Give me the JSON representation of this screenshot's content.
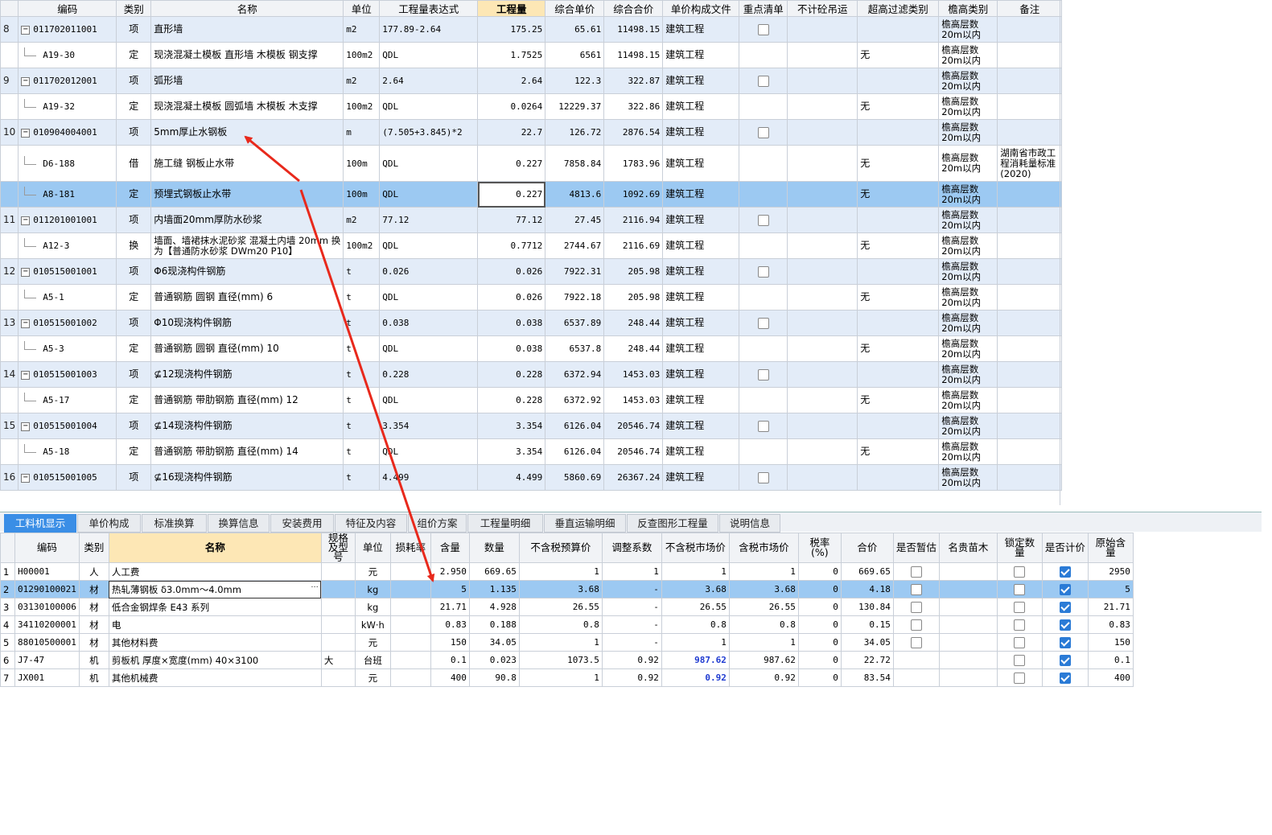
{
  "top_table": {
    "headers": [
      "",
      "编码",
      "类别",
      "名称",
      "单位",
      "工程量表达式",
      "工程量",
      "综合单价",
      "综合合价",
      "单价构成文件",
      "重点清单",
      "不计砼吊运",
      "超高过滤类别",
      "檐高类别",
      "备注"
    ],
    "rows": [
      {
        "rn": "8",
        "kind": "parent",
        "code": "011702011001",
        "type": "项",
        "name": "直形墙",
        "unit": "m2",
        "expr": "177.89-2.64",
        "qty": "175.25",
        "uprice": "65.61",
        "total": "11498.15",
        "file": "建筑工程",
        "filter": "",
        "eave": "檐高层数20m以内",
        "note": ""
      },
      {
        "rn": "",
        "kind": "child",
        "code": "A19-30",
        "type": "定",
        "name": "现浇混凝土模板 直形墙 木模板 钢支撑",
        "unit": "100m2",
        "expr": "QDL",
        "qty": "1.7525",
        "uprice": "6561",
        "total": "11498.15",
        "file": "建筑工程",
        "filter": "无",
        "eave": "檐高层数20m以内",
        "note": ""
      },
      {
        "rn": "9",
        "kind": "parent",
        "code": "011702012001",
        "type": "项",
        "name": "弧形墙",
        "unit": "m2",
        "expr": "2.64",
        "qty": "2.64",
        "uprice": "122.3",
        "total": "322.87",
        "file": "建筑工程",
        "filter": "",
        "eave": "檐高层数20m以内",
        "note": ""
      },
      {
        "rn": "",
        "kind": "child",
        "code": "A19-32",
        "type": "定",
        "name": "现浇混凝土模板 圆弧墙 木模板 木支撑",
        "unit": "100m2",
        "expr": "QDL",
        "qty": "0.0264",
        "uprice": "12229.37",
        "total": "322.86",
        "file": "建筑工程",
        "filter": "无",
        "eave": "檐高层数20m以内",
        "note": ""
      },
      {
        "rn": "10",
        "kind": "parent",
        "code": "010904004001",
        "type": "项",
        "name": "5mm厚止水钢板",
        "unit": "m",
        "expr": "(7.505+3.845)*2",
        "qty": "22.7",
        "uprice": "126.72",
        "total": "2876.54",
        "file": "建筑工程",
        "filter": "",
        "eave": "檐高层数20m以内",
        "note": ""
      },
      {
        "rn": "",
        "kind": "child tall",
        "code": "D6-188",
        "type": "借",
        "name": "施工缝 钢板止水带",
        "unit": "100m",
        "expr": "QDL",
        "qty": "0.227",
        "uprice": "7858.84",
        "total": "1783.96",
        "file": "建筑工程",
        "filter": "无",
        "eave": "檐高层数20m以内",
        "note": "湖南省市政工程消耗量标准(2020)"
      },
      {
        "rn": "",
        "kind": "sel",
        "code": "A8-181",
        "type": "定",
        "name": "预埋式钢板止水带",
        "unit": "100m",
        "expr": "QDL",
        "qty": "0.227",
        "uprice": "4813.6",
        "total": "1092.69",
        "file": "建筑工程",
        "filter": "无",
        "eave": "檐高层数20m以内",
        "note": ""
      },
      {
        "rn": "11",
        "kind": "parent",
        "code": "011201001001",
        "type": "项",
        "name": "内墙面20mm厚防水砂浆",
        "unit": "m2",
        "expr": "77.12",
        "qty": "77.12",
        "uprice": "27.45",
        "total": "2116.94",
        "file": "建筑工程",
        "filter": "",
        "eave": "檐高层数20m以内",
        "note": ""
      },
      {
        "rn": "",
        "kind": "child",
        "code": "A12-3",
        "type": "换",
        "name": "墙面、墙裙抹水泥砂浆 混凝土内墙 20mm 换为【普通防水砂浆 DWm20 P10】",
        "unit": "100m2",
        "expr": "QDL",
        "qty": "0.7712",
        "uprice": "2744.67",
        "total": "2116.69",
        "file": "建筑工程",
        "filter": "无",
        "eave": "檐高层数20m以内",
        "note": ""
      },
      {
        "rn": "12",
        "kind": "parent",
        "code": "010515001001",
        "type": "项",
        "name": "Φ6现浇构件钢筋",
        "unit": "t",
        "expr": "0.026",
        "qty": "0.026",
        "uprice": "7922.31",
        "total": "205.98",
        "file": "建筑工程",
        "filter": "",
        "eave": "檐高层数20m以内",
        "note": ""
      },
      {
        "rn": "",
        "kind": "child",
        "code": "A5-1",
        "type": "定",
        "name": "普通钢筋 圆钢 直径(mm) 6",
        "unit": "t",
        "expr": "QDL",
        "qty": "0.026",
        "uprice": "7922.18",
        "total": "205.98",
        "file": "建筑工程",
        "filter": "无",
        "eave": "檐高层数20m以内",
        "note": ""
      },
      {
        "rn": "13",
        "kind": "parent",
        "code": "010515001002",
        "type": "项",
        "name": "Φ10现浇构件钢筋",
        "unit": "t",
        "expr": "0.038",
        "qty": "0.038",
        "uprice": "6537.89",
        "total": "248.44",
        "file": "建筑工程",
        "filter": "",
        "eave": "檐高层数20m以内",
        "note": ""
      },
      {
        "rn": "",
        "kind": "child",
        "code": "A5-3",
        "type": "定",
        "name": "普通钢筋 圆钢 直径(mm) 10",
        "unit": "t",
        "expr": "QDL",
        "qty": "0.038",
        "uprice": "6537.8",
        "total": "248.44",
        "file": "建筑工程",
        "filter": "无",
        "eave": "檐高层数20m以内",
        "note": ""
      },
      {
        "rn": "14",
        "kind": "parent",
        "code": "010515001003",
        "type": "项",
        "name": "⊈12现浇构件钢筋",
        "unit": "t",
        "expr": "0.228",
        "qty": "0.228",
        "uprice": "6372.94",
        "total": "1453.03",
        "file": "建筑工程",
        "filter": "",
        "eave": "檐高层数20m以内",
        "note": ""
      },
      {
        "rn": "",
        "kind": "child",
        "code": "A5-17",
        "type": "定",
        "name": "普通钢筋 带肋钢筋 直径(mm) 12",
        "unit": "t",
        "expr": "QDL",
        "qty": "0.228",
        "uprice": "6372.92",
        "total": "1453.03",
        "file": "建筑工程",
        "filter": "无",
        "eave": "檐高层数20m以内",
        "note": ""
      },
      {
        "rn": "15",
        "kind": "parent",
        "code": "010515001004",
        "type": "项",
        "name": "⊈14现浇构件钢筋",
        "unit": "t",
        "expr": "3.354",
        "qty": "3.354",
        "uprice": "6126.04",
        "total": "20546.74",
        "file": "建筑工程",
        "filter": "",
        "eave": "檐高层数20m以内",
        "note": ""
      },
      {
        "rn": "",
        "kind": "child",
        "code": "A5-18",
        "type": "定",
        "name": "普通钢筋 带肋钢筋 直径(mm) 14",
        "unit": "t",
        "expr": "QDL",
        "qty": "3.354",
        "uprice": "6126.04",
        "total": "20546.74",
        "file": "建筑工程",
        "filter": "无",
        "eave": "檐高层数20m以内",
        "note": ""
      },
      {
        "rn": "16",
        "kind": "parent",
        "code": "010515001005",
        "type": "项",
        "name": "⊈16现浇构件钢筋",
        "unit": "t",
        "expr": "4.499",
        "qty": "4.499",
        "uprice": "5860.69",
        "total": "26367.24",
        "file": "建筑工程",
        "filter": "",
        "eave": "檐高层数20m以内",
        "note": ""
      }
    ]
  },
  "tabs": [
    "工料机显示",
    "单价构成",
    "标准换算",
    "换算信息",
    "安装费用",
    "特征及内容",
    "组价方案",
    "工程量明细",
    "垂直运输明细",
    "反查图形工程量",
    "说明信息"
  ],
  "bottom_table": {
    "headers": [
      "",
      "编码",
      "类别",
      "名称",
      "规格及型号",
      "单位",
      "损耗率",
      "含量",
      "数量",
      "不含税预算价",
      "调整系数",
      "不含税市场价",
      "含税市场价",
      "税率(%)",
      "合价",
      "是否暂估",
      "名贵苗木",
      "锁定数量",
      "是否计价",
      "原始含量"
    ],
    "rows": [
      {
        "rn": "1",
        "code": "H00001",
        "type": "人",
        "name": "人工费",
        "spec": "",
        "unit": "元",
        "loss": "",
        "content": "2.950",
        "qty": "669.65",
        "budget": "1",
        "coef": "1",
        "market": "1",
        "tax_market": "1",
        "tax": "0",
        "total": "669.65",
        "est": false,
        "rare": "",
        "locked": false,
        "priced": true,
        "orig": "2950"
      },
      {
        "rn": "2",
        "code": "01290100021",
        "type": "材",
        "name": "热轧薄钢板 δ3.0mm～4.0mm",
        "spec": "",
        "unit": "kg",
        "loss": "",
        "content": "5",
        "qty": "1.135",
        "budget": "3.68",
        "coef": "-",
        "market": "3.68",
        "tax_market": "3.68",
        "tax": "0",
        "total": "4.18",
        "est": false,
        "rare": "",
        "locked": false,
        "priced": true,
        "orig": "5",
        "sel": true
      },
      {
        "rn": "3",
        "code": "03130100006",
        "type": "材",
        "name": "低合金钢焊条 E43 系列",
        "spec": "",
        "unit": "kg",
        "loss": "",
        "content": "21.71",
        "qty": "4.928",
        "budget": "26.55",
        "coef": "-",
        "market": "26.55",
        "tax_market": "26.55",
        "tax": "0",
        "total": "130.84",
        "est": false,
        "rare": "",
        "locked": false,
        "priced": true,
        "orig": "21.71"
      },
      {
        "rn": "4",
        "code": "34110200001",
        "type": "材",
        "name": "电",
        "spec": "",
        "unit": "kW·h",
        "loss": "",
        "content": "0.83",
        "qty": "0.188",
        "budget": "0.8",
        "coef": "-",
        "market": "0.8",
        "tax_market": "0.8",
        "tax": "0",
        "total": "0.15",
        "est": false,
        "rare": "",
        "locked": false,
        "priced": true,
        "orig": "0.83"
      },
      {
        "rn": "5",
        "code": "88010500001",
        "type": "材",
        "name": "其他材料费",
        "spec": "",
        "unit": "元",
        "loss": "",
        "content": "150",
        "qty": "34.05",
        "budget": "1",
        "coef": "-",
        "market": "1",
        "tax_market": "1",
        "tax": "0",
        "total": "34.05",
        "est": false,
        "rare": "",
        "locked": false,
        "priced": true,
        "orig": "150"
      },
      {
        "rn": "6",
        "code": "J7-47",
        "type": "机",
        "name": "剪板机 厚度×宽度(mm) 40×3100",
        "spec": "大",
        "unit": "台班",
        "loss": "",
        "content": "0.1",
        "qty": "0.023",
        "budget": "1073.5",
        "coef": "0.92",
        "market": "987.62",
        "tax_market": "987.62",
        "tax": "0",
        "total": "22.72",
        "est": null,
        "rare": "",
        "locked": false,
        "priced": true,
        "orig": "0.1",
        "blue": true
      },
      {
        "rn": "7",
        "code": "JX001",
        "type": "机",
        "name": "其他机械费",
        "spec": "",
        "unit": "元",
        "loss": "",
        "content": "400",
        "qty": "90.8",
        "budget": "1",
        "coef": "0.92",
        "market": "0.92",
        "tax_market": "0.92",
        "tax": "0",
        "total": "83.54",
        "est": null,
        "rare": "",
        "locked": false,
        "priced": true,
        "orig": "400",
        "blue": true
      }
    ]
  },
  "colors": {
    "parent_row": "#e3ecf8",
    "selected_row": "#9cc9f2",
    "active_tab": "#3a8ee6",
    "arrow": "#e8291c",
    "header_highlight": "#fde7b5"
  }
}
